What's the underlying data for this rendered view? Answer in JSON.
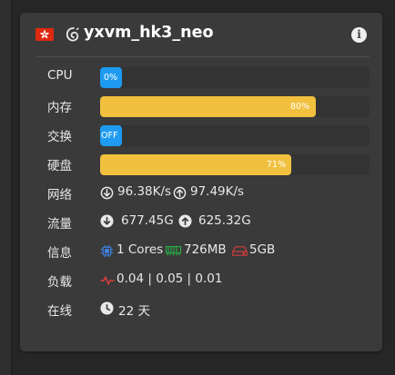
{
  "server": {
    "name": "yxvm_hk3_neo",
    "flag_icon": "hong-kong-flag-icon",
    "os_icon": "debian-icon",
    "info_icon": "info-icon"
  },
  "rows": {
    "cpu": {
      "label": "CPU",
      "text": "0%",
      "fraction": 0.0,
      "color": "#1e9bf0"
    },
    "memory": {
      "label": "内存",
      "text": "80%",
      "fraction": 0.8,
      "color": "#f1c03e"
    },
    "swap": {
      "label": "交换",
      "text": "OFF",
      "fraction": 0.0,
      "color": "#1e9bf0"
    },
    "disk": {
      "label": "硬盘",
      "text": "71%",
      "fraction": 0.71,
      "color": "#f1c03e"
    },
    "network": {
      "label": "网络",
      "down": "96.38K/s",
      "up": "97.49K/s"
    },
    "traffic": {
      "label": "流量",
      "down": "677.45G",
      "up": "625.32G"
    },
    "info": {
      "label": "信息",
      "cores": "1 Cores",
      "memory": "726MB",
      "disk": "5GB"
    },
    "load": {
      "label": "负载",
      "value": "0.04 | 0.05 | 0.01"
    },
    "uptime": {
      "label": "在线",
      "value": "22 天"
    }
  },
  "colors": {
    "accent_blue": "#1e9bf0",
    "accent_yellow": "#f1c03e",
    "cpu_icon": "#3f7fe0",
    "ram_icon": "#27a844",
    "disk_icon": "#d23b3b",
    "load_icon": "#e23c3c"
  }
}
